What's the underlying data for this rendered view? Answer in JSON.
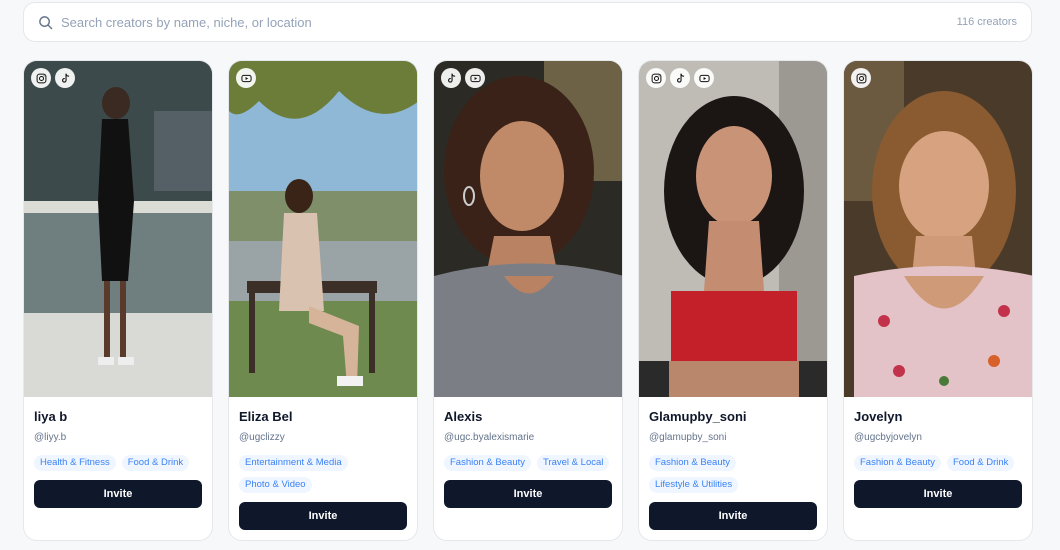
{
  "search": {
    "placeholder": "Search creators by name, niche, or location",
    "count_label": "116 creators"
  },
  "creators": [
    {
      "name": "liya b",
      "handle": "@liyy.b",
      "socials": [
        "instagram-icon",
        "tiktok-icon"
      ],
      "tags": [
        "Health & Fitness",
        "Food & Drink"
      ],
      "invite_label": "Invite"
    },
    {
      "name": "Eliza Bel",
      "handle": "@ugclizzy",
      "socials": [
        "youtube-icon"
      ],
      "tags": [
        "Entertainment & Media",
        "Photo & Video"
      ],
      "invite_label": "Invite"
    },
    {
      "name": "Alexis",
      "handle": "@ugc.byalexismarie",
      "socials": [
        "tiktok-icon",
        "youtube-icon"
      ],
      "tags": [
        "Fashion & Beauty",
        "Travel & Local"
      ],
      "invite_label": "Invite"
    },
    {
      "name": "Glamupby_soni",
      "handle": "@glamupby_soni",
      "socials": [
        "instagram-icon",
        "tiktok-icon",
        "youtube-icon"
      ],
      "tags": [
        "Fashion & Beauty",
        "Lifestyle & Utilities"
      ],
      "invite_label": "Invite"
    },
    {
      "name": "Jovelyn",
      "handle": "@ugcbyjovelyn",
      "socials": [
        "instagram-icon"
      ],
      "tags": [
        "Fashion & Beauty",
        "Food & Drink"
      ],
      "invite_label": "Invite"
    }
  ],
  "colors": {
    "tag_text": "#3b82f6",
    "tag_bg": "#eff6ff",
    "button_bg": "#0f172a"
  }
}
